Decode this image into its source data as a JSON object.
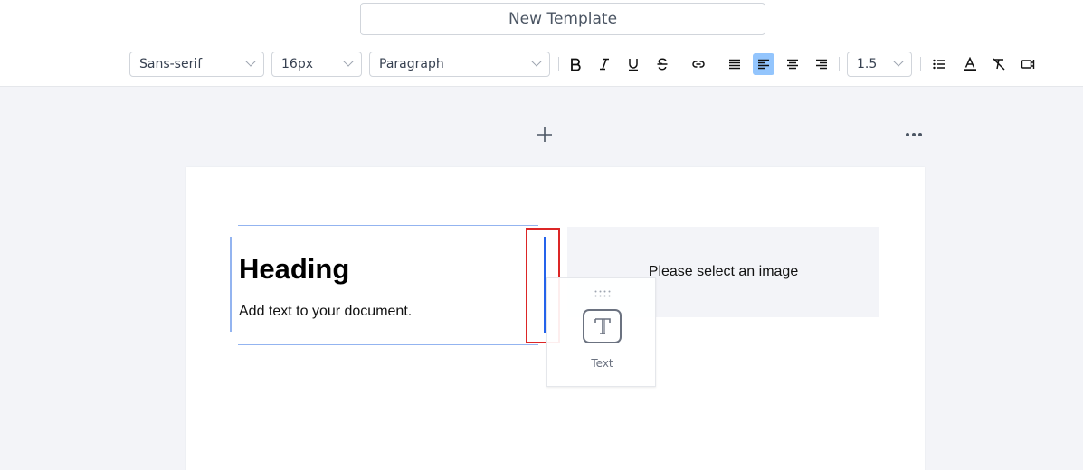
{
  "header": {
    "template_title": "New Template"
  },
  "toolbar": {
    "font_family": "Sans-serif",
    "font_size": "16px",
    "block_type": "Paragraph",
    "line_height": "1.5",
    "active_align": "align-left"
  },
  "editor": {
    "heading": "Heading",
    "body": "Add text to your document.",
    "image_placeholder": "Please select an image"
  },
  "drag_item": {
    "label": "Text"
  },
  "colors": {
    "accent": "#2563eb",
    "active_button": "#93c5fd",
    "drop_marker": "#dc2626",
    "page_bg": "#f3f4f8"
  }
}
